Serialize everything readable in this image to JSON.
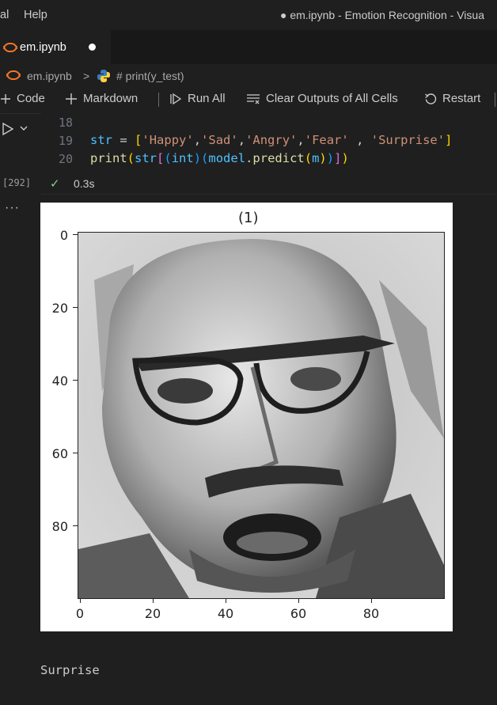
{
  "titlebar": {
    "menu_partial": "al",
    "menu_help": "Help",
    "window_title": "● em.ipynb - Emotion Recognition - Visua"
  },
  "tab": {
    "filename": "em.ipynb"
  },
  "breadcrumb": {
    "file": "em.ipynb",
    "separator": ">",
    "symbol": "# print(y_test)"
  },
  "toolbar": {
    "code_label": "Code",
    "markdown_label": "Markdown",
    "run_all_label": "Run All",
    "clear_outputs_label": "Clear Outputs of All Cells",
    "restart_label": "Restart"
  },
  "cell": {
    "execution_count": "[292]",
    "status_time": "0.3s",
    "lines": [
      {
        "number": "18",
        "text": ""
      },
      {
        "number": "19",
        "text": "str = ['Happy','Sad','Angry','Fear' , 'Surprise']"
      },
      {
        "number": "20",
        "text": "print(str[(int)(model.predict(m))])"
      }
    ]
  },
  "figure": {
    "title": "(1)",
    "y_ticks": [
      "0",
      "20",
      "40",
      "60",
      "80"
    ],
    "x_ticks": [
      "0",
      "20",
      "40",
      "60",
      "80"
    ],
    "image_kind": "grayscale face photo"
  },
  "output": {
    "stdout": "Surprise"
  },
  "colors": {
    "keyword": "#4fc1ff",
    "string": "#ce9178",
    "function": "#dcdcaa",
    "bracket1": "#ffd700",
    "bracket2": "#da70d6",
    "bracket3": "#179fff",
    "success": "#89d185",
    "jupyter": "#f37626"
  }
}
